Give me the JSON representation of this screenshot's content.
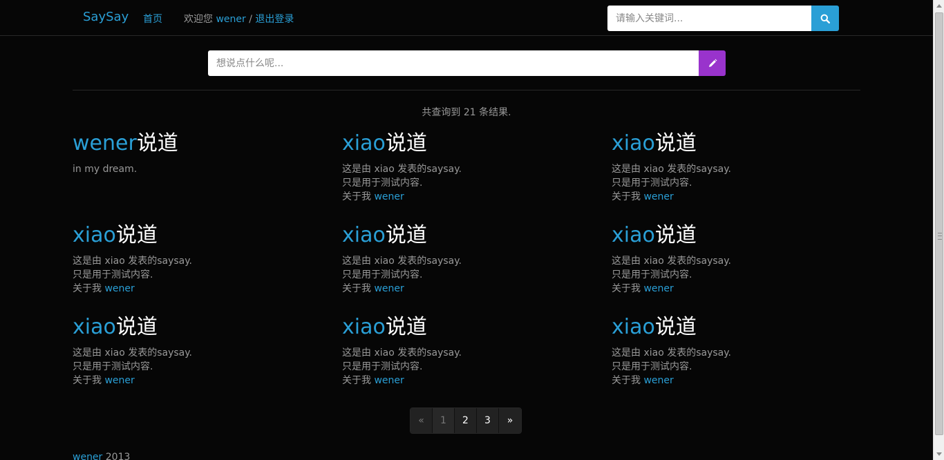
{
  "navbar": {
    "brand": "SaySay",
    "home": "首页",
    "welcome_prefix": "欢迎您 ",
    "username": "wener",
    "separator": " / ",
    "logout": "退出登录",
    "search_placeholder": "请输入关键词..."
  },
  "post": {
    "placeholder": "想说点什么呢..."
  },
  "results": {
    "count_text": "共查询到 21 条结果."
  },
  "title_suffix": "说道",
  "cards": [
    {
      "user": "wener",
      "lines": [
        "in my dream."
      ],
      "about_prefix": "",
      "about_link": ""
    },
    {
      "user": "xiao",
      "lines": [
        "这是由 xiao 发表的saysay.",
        "只是用于测试内容."
      ],
      "about_prefix": "关于我 ",
      "about_link": "wener"
    },
    {
      "user": "xiao",
      "lines": [
        "这是由 xiao 发表的saysay.",
        "只是用于测试内容."
      ],
      "about_prefix": "关于我 ",
      "about_link": "wener"
    },
    {
      "user": "xiao",
      "lines": [
        "这是由 xiao 发表的saysay.",
        "只是用于测试内容."
      ],
      "about_prefix": "关于我 ",
      "about_link": "wener"
    },
    {
      "user": "xiao",
      "lines": [
        "这是由 xiao 发表的saysay.",
        "只是用于测试内容."
      ],
      "about_prefix": "关于我 ",
      "about_link": "wener"
    },
    {
      "user": "xiao",
      "lines": [
        "这是由 xiao 发表的saysay.",
        "只是用于测试内容."
      ],
      "about_prefix": "关于我 ",
      "about_link": "wener"
    },
    {
      "user": "xiao",
      "lines": [
        "这是由 xiao 发表的saysay.",
        "只是用于测试内容."
      ],
      "about_prefix": "关于我 ",
      "about_link": "wener"
    },
    {
      "user": "xiao",
      "lines": [
        "这是由 xiao 发表的saysay.",
        "只是用于测试内容."
      ],
      "about_prefix": "关于我 ",
      "about_link": "wener"
    },
    {
      "user": "xiao",
      "lines": [
        "这是由 xiao 发表的saysay.",
        "只是用于测试内容."
      ],
      "about_prefix": "关于我 ",
      "about_link": "wener"
    }
  ],
  "pagination": {
    "prev": "«",
    "pages": [
      "1",
      "2",
      "3"
    ],
    "current": "1",
    "next": "»"
  },
  "footer": {
    "author": "wener",
    "year": " 2013"
  },
  "icons": {
    "search": "search-icon",
    "post": "pencil-icon"
  },
  "colors": {
    "accent": "#2a9fd6",
    "post_button": "#9933cc",
    "background": "#060606"
  }
}
